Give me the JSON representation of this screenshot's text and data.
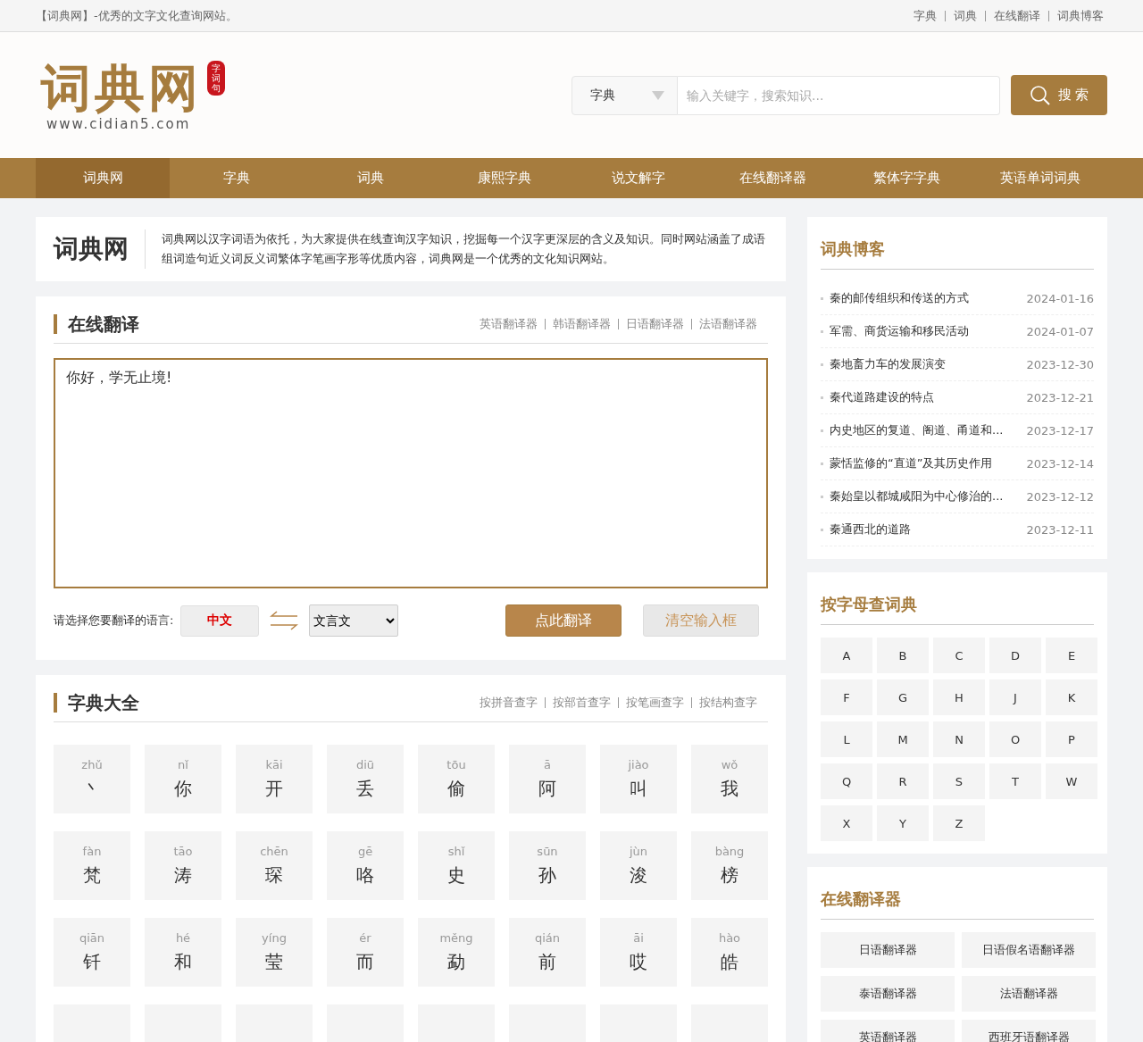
{
  "top_bar": {
    "tagline": "【词典网】-优秀的文字文化查询网站。",
    "links": [
      "字典",
      "词典",
      "在线翻译",
      "词典博客"
    ]
  },
  "header": {
    "logo": {
      "title": "词典网",
      "seal": "字词句",
      "url": "www.cidian5.com"
    },
    "search": {
      "category": "字典",
      "placeholder": "输入关键字，搜索知识...",
      "button": "搜 索"
    }
  },
  "nav": [
    {
      "label": "词典网",
      "selected": true
    },
    {
      "label": "字典",
      "selected": false
    },
    {
      "label": "词典",
      "selected": false
    },
    {
      "label": "康熙字典",
      "selected": false
    },
    {
      "label": "说文解字",
      "selected": false
    },
    {
      "label": "在线翻译器",
      "selected": false
    },
    {
      "label": "繁体字字典",
      "selected": false
    },
    {
      "label": "英语单词词典",
      "selected": false
    }
  ],
  "intro": {
    "title": "词典网",
    "text": "词典网以汉字词语为依托，为大家提供在线查询汉字知识，挖掘每一个汉字更深层的含义及知识。同时网站涵盖了成语组词造句近义词反义词繁体字笔画字形等优质内容，词典网是一个优秀的文化知识网站。"
  },
  "translate": {
    "title": "在线翻译",
    "links": [
      "英语翻译器",
      "韩语翻译器",
      "日语翻译器",
      "法语翻译器"
    ],
    "input": "你好，学无止境!",
    "language_label": "请选择您要翻译的语言:",
    "source_language": "中文",
    "target_language": "文言文",
    "translate_button": "点此翻译",
    "clear_button": "清空输入框"
  },
  "dictionary": {
    "title": "字典大全",
    "links": [
      "按拼音查字",
      "按部首查字",
      "按笔画查字",
      "按结构查字"
    ],
    "characters": [
      {
        "pinyin": "zhǔ",
        "char": "丶"
      },
      {
        "pinyin": "nǐ",
        "char": "你"
      },
      {
        "pinyin": "kāi",
        "char": "开"
      },
      {
        "pinyin": "diū",
        "char": "丢"
      },
      {
        "pinyin": "tōu",
        "char": "偷"
      },
      {
        "pinyin": "ā",
        "char": "阿"
      },
      {
        "pinyin": "jiào",
        "char": "叫"
      },
      {
        "pinyin": "wǒ",
        "char": "我"
      },
      {
        "pinyin": "fàn",
        "char": "梵"
      },
      {
        "pinyin": "tāo",
        "char": "涛"
      },
      {
        "pinyin": "chēn",
        "char": "琛"
      },
      {
        "pinyin": "gē",
        "char": "咯"
      },
      {
        "pinyin": "shǐ",
        "char": "史"
      },
      {
        "pinyin": "sūn",
        "char": "孙"
      },
      {
        "pinyin": "jùn",
        "char": "浚"
      },
      {
        "pinyin": "bàng",
        "char": "榜"
      },
      {
        "pinyin": "qiān",
        "char": "钎"
      },
      {
        "pinyin": "hé",
        "char": "和"
      },
      {
        "pinyin": "yíng",
        "char": "莹"
      },
      {
        "pinyin": "ér",
        "char": "而"
      },
      {
        "pinyin": "měng",
        "char": "勐"
      },
      {
        "pinyin": "qián",
        "char": "前"
      },
      {
        "pinyin": "āi",
        "char": "哎"
      },
      {
        "pinyin": "hào",
        "char": "皓"
      }
    ]
  },
  "blog": {
    "title": "词典博客",
    "posts": [
      {
        "title": "秦的邮传组织和传送的方式",
        "date": "2024-01-16"
      },
      {
        "title": "军需、商货运输和移民活动",
        "date": "2024-01-07"
      },
      {
        "title": "秦地畜力车的发展演变",
        "date": "2023-12-30"
      },
      {
        "title": "秦代道路建设的特点",
        "date": "2023-12-21"
      },
      {
        "title": "内史地区的复道、阁道、甬道和...",
        "date": "2023-12-17"
      },
      {
        "title": "蒙恬监修的“直道”及其历史作用",
        "date": "2023-12-14"
      },
      {
        "title": "秦始皇以都城咸阳为中心修治的...",
        "date": "2023-12-12"
      },
      {
        "title": "秦通西北的道路",
        "date": "2023-12-11"
      }
    ]
  },
  "letters": {
    "title": "按字母查词典",
    "items": [
      "A",
      "B",
      "C",
      "D",
      "E",
      "F",
      "G",
      "H",
      "J",
      "K",
      "L",
      "M",
      "N",
      "O",
      "P",
      "Q",
      "R",
      "S",
      "T",
      "W",
      "X",
      "Y",
      "Z"
    ]
  },
  "translators": {
    "title": "在线翻译器",
    "items": [
      "日语翻译器",
      "日语假名语翻译器",
      "泰语翻译器",
      "法语翻译器",
      "英语翻译器",
      "西班牙语翻译器"
    ]
  }
}
